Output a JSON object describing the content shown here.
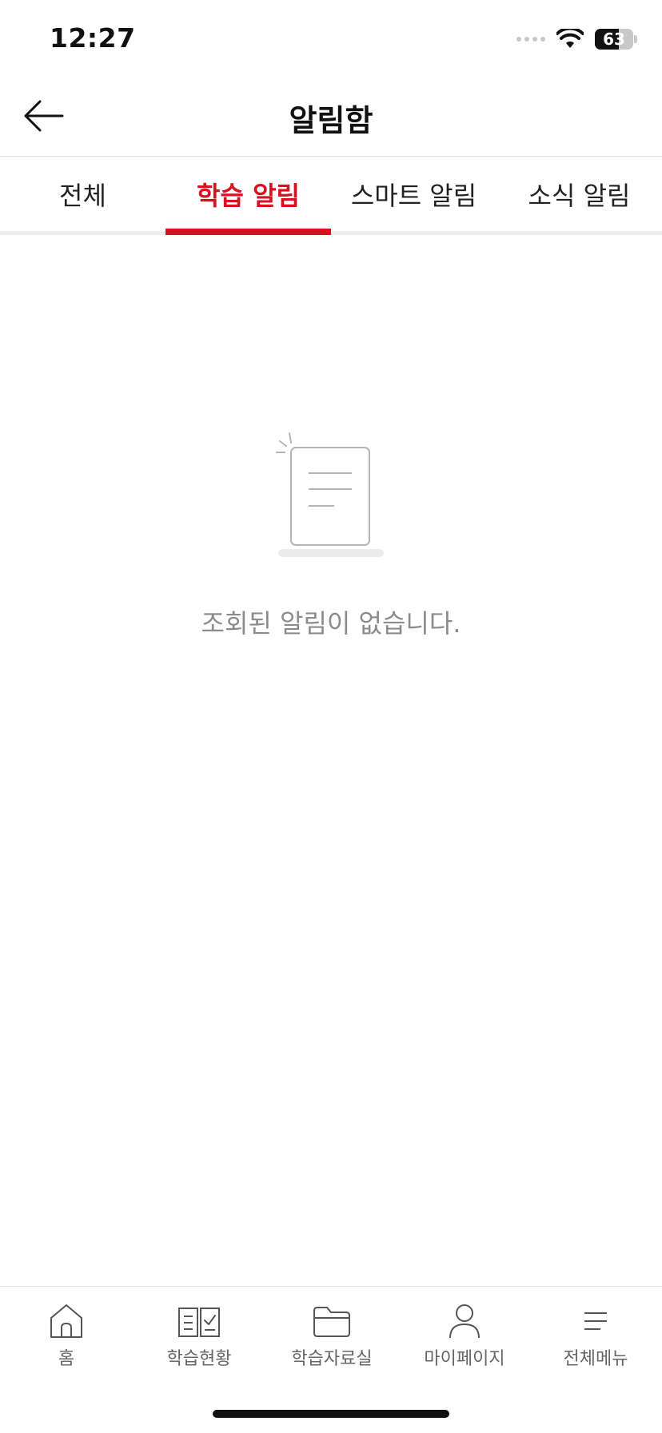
{
  "status_bar": {
    "time": "12:27",
    "battery": "63",
    "battery_level_percent": 63
  },
  "header": {
    "title": "알림함",
    "back_icon": "arrow-left-icon"
  },
  "tabs": [
    {
      "label": "전체",
      "active": false
    },
    {
      "label": "학습 알림",
      "active": true
    },
    {
      "label": "스마트 알림",
      "active": false
    },
    {
      "label": "소식 알림",
      "active": false
    }
  ],
  "empty_state": {
    "message": "조회된 알림이 없습니다.",
    "icon": "document-icon"
  },
  "bottom_nav": [
    {
      "label": "홈",
      "icon": "home-icon"
    },
    {
      "label": "학습현황",
      "icon": "book-check-icon"
    },
    {
      "label": "학습자료실",
      "icon": "folder-icon"
    },
    {
      "label": "마이페이지",
      "icon": "person-icon"
    },
    {
      "label": "전체메뉴",
      "icon": "menu-icon"
    }
  ],
  "colors": {
    "accent": "#d9101f",
    "muted_text": "#8c8c8c",
    "divider": "#e4e4e4"
  }
}
